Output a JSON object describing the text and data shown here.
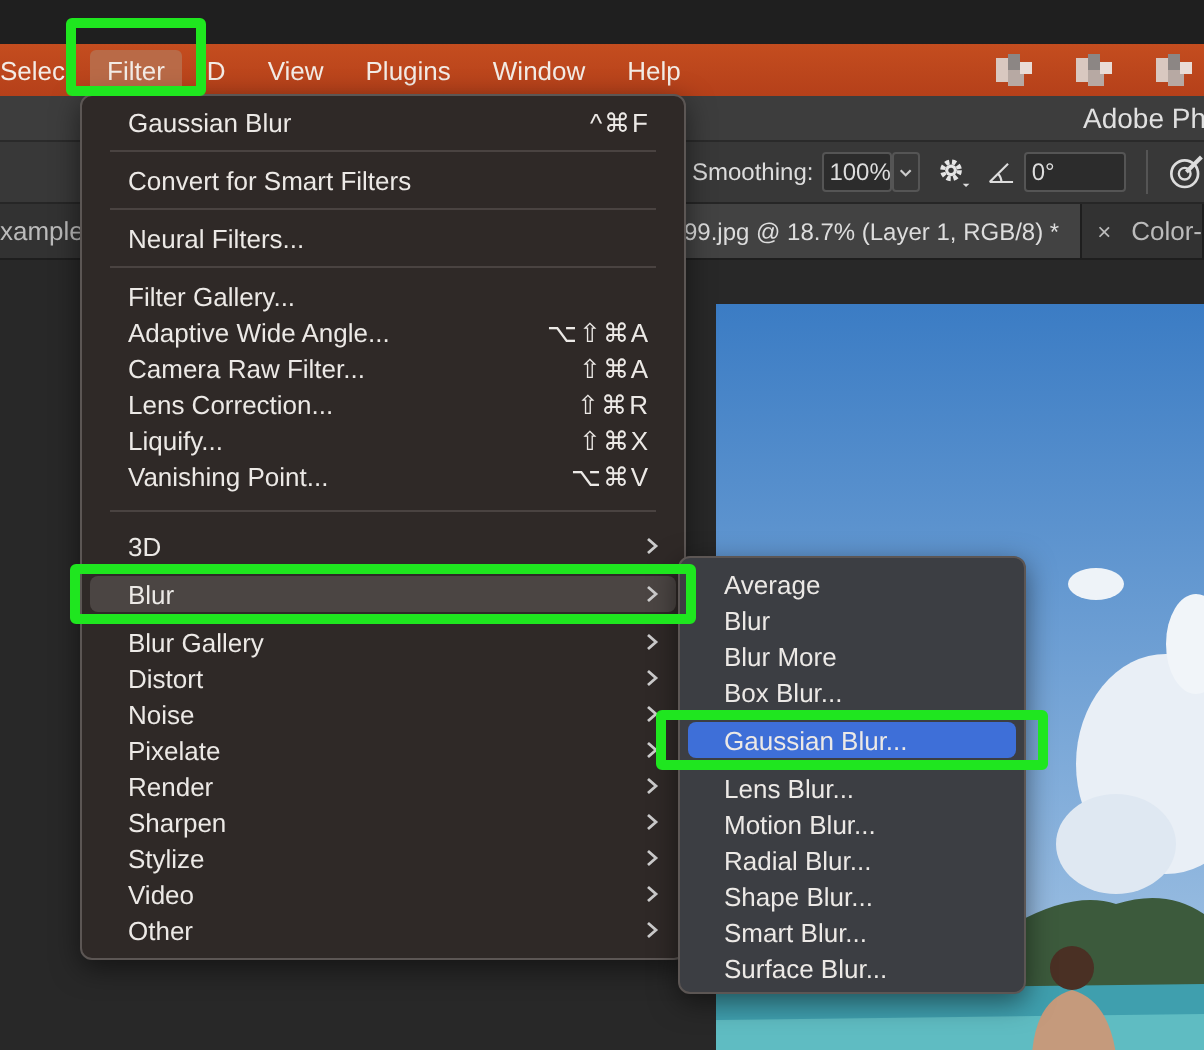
{
  "menubar": {
    "items": [
      {
        "label": "Selec",
        "selected": false
      },
      {
        "label": "Filter",
        "selected": true
      },
      {
        "label": "D",
        "selected": false
      },
      {
        "label": "View",
        "selected": false
      },
      {
        "label": "Plugins",
        "selected": false
      },
      {
        "label": "Window",
        "selected": false
      },
      {
        "label": "Help",
        "selected": false
      }
    ]
  },
  "app_title": "Adobe Ph",
  "options_bar": {
    "smoothing_label": "Smoothing:",
    "smoothing_value": "100%",
    "angle_value": "0°"
  },
  "document_tabs": [
    {
      "label": "xample",
      "selected": false
    },
    {
      "label": "99.jpg @ 18.7% (Layer 1, RGB/8) *",
      "selected": true
    },
    {
      "label": "Color-",
      "selected": false,
      "close": "×"
    }
  ],
  "filter_menu": {
    "groups": [
      [
        {
          "label": "Gaussian Blur",
          "shortcut": "^⌘F",
          "submenu": false,
          "selected": false
        }
      ],
      [
        {
          "label": "Convert for Smart Filters",
          "submenu": false,
          "selected": false
        }
      ],
      [
        {
          "label": "Neural Filters...",
          "submenu": false,
          "selected": false
        }
      ],
      [
        {
          "label": "Filter Gallery...",
          "submenu": false,
          "selected": false
        },
        {
          "label": "Adaptive Wide Angle...",
          "shortcut": "⌥⇧⌘A",
          "submenu": false,
          "selected": false
        },
        {
          "label": "Camera Raw Filter...",
          "shortcut": "⇧⌘A",
          "submenu": false,
          "selected": false
        },
        {
          "label": "Lens Correction...",
          "shortcut": "⇧⌘R",
          "submenu": false,
          "selected": false
        },
        {
          "label": "Liquify...",
          "shortcut": "⇧⌘X",
          "submenu": false,
          "selected": false
        },
        {
          "label": "Vanishing Point...",
          "shortcut": "⌥⌘V",
          "submenu": false,
          "selected": false
        }
      ],
      [
        {
          "label": "3D",
          "submenu": true,
          "selected": false
        },
        {
          "label": "Blur",
          "submenu": true,
          "selected": true
        },
        {
          "label": "Blur Gallery",
          "submenu": true,
          "selected": false
        },
        {
          "label": "Distort",
          "submenu": true,
          "selected": false
        },
        {
          "label": "Noise",
          "submenu": true,
          "selected": false
        },
        {
          "label": "Pixelate",
          "submenu": true,
          "selected": false
        },
        {
          "label": "Render",
          "submenu": true,
          "selected": false
        },
        {
          "label": "Sharpen",
          "submenu": true,
          "selected": false
        },
        {
          "label": "Stylize",
          "submenu": true,
          "selected": false
        },
        {
          "label": "Video",
          "submenu": true,
          "selected": false
        },
        {
          "label": "Other",
          "submenu": true,
          "selected": false
        }
      ]
    ]
  },
  "blur_submenu": {
    "groups": [
      [
        {
          "label": "Average",
          "submenu": false,
          "selected": false
        },
        {
          "label": "Blur",
          "submenu": false,
          "selected": false
        },
        {
          "label": "Blur More",
          "submenu": false,
          "selected": false
        },
        {
          "label": "Box Blur...",
          "submenu": false,
          "selected": false
        },
        {
          "label": "Gaussian Blur...",
          "submenu": false,
          "selected": true
        },
        {
          "label": "Lens Blur...",
          "submenu": false,
          "selected": false
        },
        {
          "label": "Motion Blur...",
          "submenu": false,
          "selected": false
        },
        {
          "label": "Radial Blur...",
          "submenu": false,
          "selected": false
        },
        {
          "label": "Shape Blur...",
          "submenu": false,
          "selected": false
        },
        {
          "label": "Smart Blur...",
          "submenu": false,
          "selected": false
        },
        {
          "label": "Surface Blur...",
          "submenu": false,
          "selected": false
        }
      ]
    ]
  }
}
